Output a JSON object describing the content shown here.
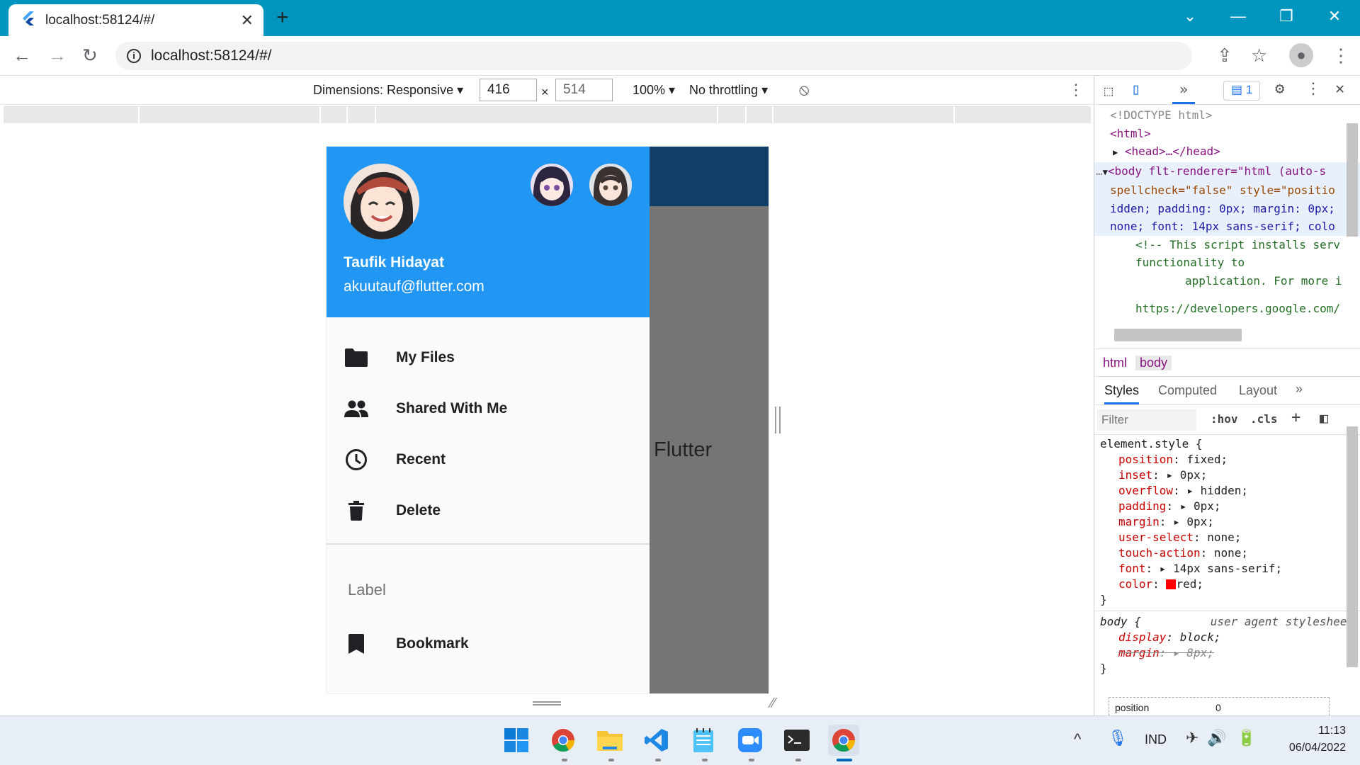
{
  "browser": {
    "tab_title": "localhost:58124/#/",
    "url": "localhost:58124/#/",
    "new_tab": "+",
    "tab_close": "✕"
  },
  "device_toolbar": {
    "dimensions_label": "Dimensions: Responsive",
    "width": "416",
    "height": "514",
    "times": "×",
    "zoom": "100%",
    "throttling": "No throttling"
  },
  "app": {
    "background_text": "Flutter",
    "user_name": "Taufik Hidayat",
    "user_email": "akuutauf@flutter.com",
    "menu_items": [
      {
        "label": "My Files",
        "icon": "folder-icon"
      },
      {
        "label": "Shared With Me",
        "icon": "people-icon"
      },
      {
        "label": "Recent",
        "icon": "clock-icon"
      },
      {
        "label": "Delete",
        "icon": "trash-icon"
      }
    ],
    "section_label": "Label",
    "bookmark_label": "Bookmark",
    "colors": {
      "header": "#2196f3",
      "appbar": "#0f3e66",
      "scrim": "#757575"
    }
  },
  "devtools": {
    "issues_count": "1",
    "elements": {
      "doctype": "<!DOCTYPE html>",
      "html_open": "<html>",
      "head": "<head>…</head>",
      "body_line1": "<body flt-renderer=\"html (auto-s",
      "body_line2": "spellcheck=\"false\" style=\"positio",
      "body_line3": "idden; padding: 0px; margin: 0px;",
      "body_line4": "none; font: 14px sans-serif; colo",
      "comment1": "<!-- This script installs serv",
      "comment2": "functionality to",
      "comment3": "application. For more i",
      "comment4": "https://developers.google.com/"
    },
    "breadcrumbs": [
      "html",
      "body"
    ],
    "style_tabs": [
      "Styles",
      "Computed",
      "Layout"
    ],
    "filter_placeholder": "Filter",
    "hov": ":hov",
    "cls": ".cls",
    "element_style_selector": "element.style {",
    "element_style": [
      {
        "prop": "position",
        "value": "fixed;"
      },
      {
        "prop": "inset",
        "value": "▸ 0px;"
      },
      {
        "prop": "overflow",
        "value": "▸ hidden;"
      },
      {
        "prop": "padding",
        "value": "▸ 0px;"
      },
      {
        "prop": "margin",
        "value": "▸ 0px;"
      },
      {
        "prop": "user-select",
        "value": "none;"
      },
      {
        "prop": "touch-action",
        "value": "none;"
      },
      {
        "prop": "font",
        "value": "▸ 14px sans-serif;"
      },
      {
        "prop": "color",
        "value": "red;"
      }
    ],
    "body_selector": "body {",
    "ua_label": "user agent stylesheet",
    "body_rules": [
      {
        "prop": "display",
        "value": "block;"
      },
      {
        "prop": "margin",
        "value": "▸ 8px;"
      }
    ],
    "box_model_label": "position",
    "box_model_value": "0"
  },
  "taskbar": {
    "lang": "IND",
    "time": "11:13",
    "date": "06/04/2022"
  }
}
